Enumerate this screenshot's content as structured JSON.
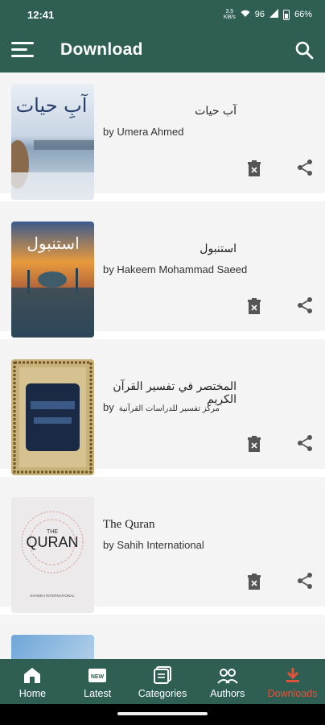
{
  "status_bar": {
    "time": "12:41",
    "net_speed_value": "3.5",
    "net_speed_unit": "KB/s",
    "signal": "96",
    "battery": "66%"
  },
  "app_bar": {
    "title": "Download",
    "menu_icon": "hamburger-menu-icon",
    "search_icon": "search-icon"
  },
  "books": [
    {
      "title": "آب حیات",
      "author": "by Umera Ahmed",
      "author_ar": ""
    },
    {
      "title": "استنبول",
      "author": "by Hakeem Mohammad Saeed",
      "author_ar": ""
    },
    {
      "title": "المختصر في تفسير القرآن الكريم",
      "author": "by",
      "author_ar": "مركز تفسير للدراسات القرآنية"
    },
    {
      "title": "The Quran",
      "author": "by Sahih International",
      "author_ar": ""
    }
  ],
  "cover_texts": {
    "book1": "آبِ حیات",
    "book2": "استنبول",
    "book4_top": "THE",
    "book4_main": "QURAN",
    "book4_sub": "SAHEEH INTERNATIONAL"
  },
  "bottom_nav": [
    {
      "label": "Home",
      "icon": "home-icon",
      "active": false
    },
    {
      "label": "Latest",
      "icon": "new-badge-icon",
      "active": false
    },
    {
      "label": "Categories",
      "icon": "categories-icon",
      "active": false
    },
    {
      "label": "Authors",
      "icon": "authors-icon",
      "active": false
    },
    {
      "label": "Downloads",
      "icon": "download-icon",
      "active": true
    }
  ],
  "colors": {
    "primary": "#2f5f53",
    "active_tab": "#e0533a"
  }
}
